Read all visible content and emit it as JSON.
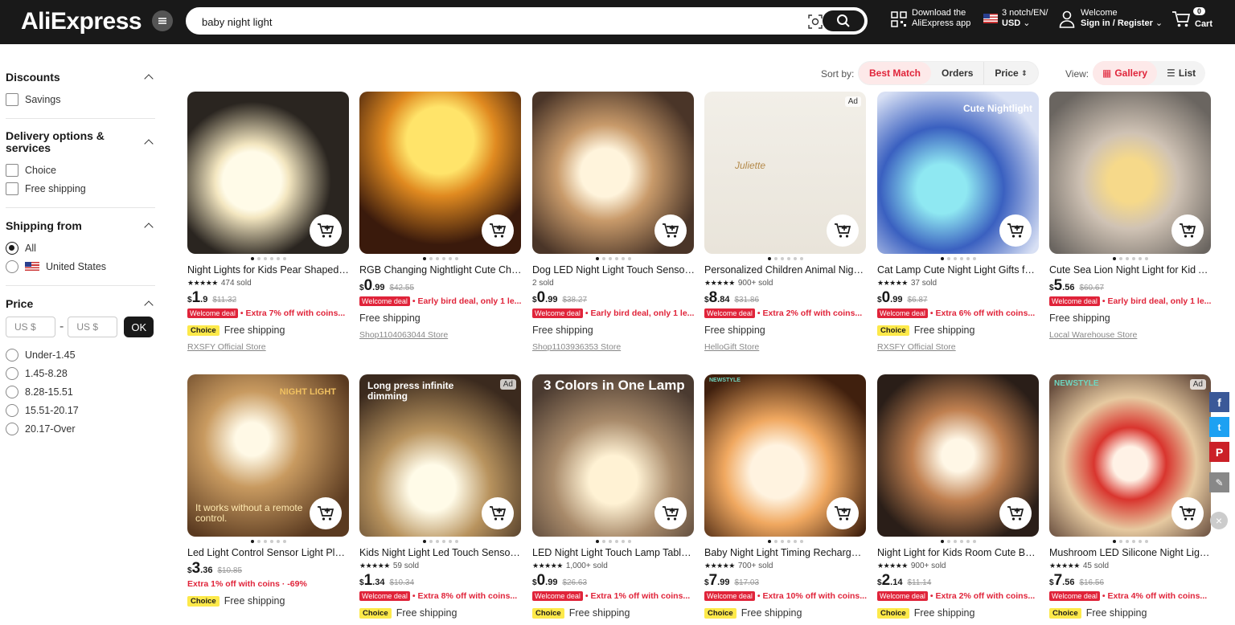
{
  "header": {
    "logo": "AliExpress",
    "search_value": "baby night light",
    "download_line1": "Download the",
    "download_line2": "AliExpress app",
    "locale_line1": "3 notch/EN/",
    "locale_line2": "USD",
    "welcome": "Welcome",
    "signin": "Sign in / Register",
    "cart_count": "0",
    "cart_label": "Cart"
  },
  "sidebar": {
    "discounts": {
      "title": "Discounts",
      "options": [
        "Savings"
      ]
    },
    "delivery": {
      "title": "Delivery options & services",
      "options": [
        "Choice",
        "Free shipping"
      ]
    },
    "shipping_from": {
      "title": "Shipping from",
      "options": [
        "All",
        "United States"
      ]
    },
    "price": {
      "title": "Price",
      "min_placeholder": "US $",
      "max_placeholder": "US $",
      "ok": "OK",
      "ranges": [
        "Under-1.45",
        "1.45-8.28",
        "8.28-15.51",
        "15.51-20.17",
        "20.17-Over"
      ]
    }
  },
  "sortbar": {
    "sort_label": "Sort by:",
    "sort_options": [
      "Best Match",
      "Orders",
      "Price"
    ],
    "view_label": "View:",
    "view_options": [
      "Gallery",
      "List"
    ]
  },
  "products": [
    {
      "title": "Night Lights for Kids Pear Shaped C...",
      "sold": "474 sold",
      "stars": true,
      "cur": "$",
      "int": "1",
      "dec": ".9",
      "old": "$11.32",
      "welcome": true,
      "deal": "Extra 7% off with coins...",
      "choice": true,
      "ship": "Free shipping",
      "store": "RXSFY Official Store",
      "ad": false
    },
    {
      "title": "RGB Changing Nightlight Cute Chick...",
      "sold": "",
      "stars": false,
      "cur": "$",
      "int": "0",
      "dec": ".99",
      "old": "$42.55",
      "welcome": true,
      "deal": "Early bird deal, only 1 le...",
      "choice": false,
      "ship": "Free shipping",
      "store": "Shop1104063044 Store",
      "ad": false
    },
    {
      "title": "Dog LED Night Light Touch Sensor ...",
      "sold": "2 sold",
      "stars": false,
      "cur": "$",
      "int": "0",
      "dec": ".99",
      "old": "$38.27",
      "welcome": true,
      "deal": "Early bird deal, only 1 le...",
      "choice": false,
      "ship": "Free shipping",
      "store": "Shop1103936353 Store",
      "ad": false
    },
    {
      "title": "Personalized Children Animal Night-...",
      "sold": "900+ sold",
      "stars": true,
      "cur": "$",
      "int": "8",
      "dec": ".84",
      "old": "$31.86",
      "welcome": true,
      "deal": "Extra 2% off with coins...",
      "choice": false,
      "ship": "Free shipping",
      "store": "HelloGift Store",
      "ad": true
    },
    {
      "title": "Cat Lamp Cute Night Light Gifts for...",
      "sold": "37 sold",
      "stars": true,
      "cur": "$",
      "int": "0",
      "dec": ".99",
      "old": "$6.87",
      "welcome": true,
      "deal": "Extra 6% off with coins...",
      "choice": true,
      "ship": "Free shipping",
      "store": "RXSFY Official Store",
      "ad": false
    },
    {
      "title": "Cute Sea Lion Night Light for Kid Ad...",
      "sold": "",
      "stars": false,
      "cur": "$",
      "int": "5",
      "dec": ".56",
      "old": "$60.67",
      "welcome": true,
      "deal": "Early bird deal, only 1 le...",
      "choice": false,
      "ship": "Free shipping",
      "store": "Local Warehouse Store",
      "ad": false
    },
    {
      "title": "Led Light Control Sensor Light Plug-...",
      "sold": "",
      "stars": false,
      "cur": "$",
      "int": "3",
      "dec": ".36",
      "old": "$10.85",
      "welcome": false,
      "deal": "Extra 1% off with coins · -69%",
      "choice": true,
      "ship": "Free shipping",
      "store": "",
      "ad": false
    },
    {
      "title": "Kids Night Light Led Touch Sensor L...",
      "sold": "59 sold",
      "stars": true,
      "cur": "$",
      "int": "1",
      "dec": ".34",
      "old": "$10.34",
      "welcome": true,
      "deal": "Extra 8% off with coins...",
      "choice": true,
      "ship": "Free shipping",
      "store": "",
      "ad": true
    },
    {
      "title": "LED Night Light Touch Lamp Table ...",
      "sold": "1,000+ sold",
      "stars": true,
      "cur": "$",
      "int": "0",
      "dec": ".99",
      "old": "$26.63",
      "welcome": true,
      "deal": "Extra 1% off with coins...",
      "choice": true,
      "ship": "Free shipping",
      "store": "",
      "ad": false
    },
    {
      "title": "Baby Night Light Timing Rechargea...",
      "sold": "700+ sold",
      "stars": true,
      "cur": "$",
      "int": "7",
      "dec": ".99",
      "old": "$17.03",
      "welcome": true,
      "deal": "Extra 10% off with coins...",
      "choice": true,
      "ship": "Free shipping",
      "store": "",
      "ad": false
    },
    {
      "title": "Night Light for Kids Room Cute Bun...",
      "sold": "900+ sold",
      "stars": true,
      "cur": "$",
      "int": "2",
      "dec": ".14",
      "old": "$11.14",
      "welcome": true,
      "deal": "Extra 2% off with coins...",
      "choice": true,
      "ship": "Free shipping",
      "store": "",
      "ad": false
    },
    {
      "title": "Mushroom LED Silicone Night Light ...",
      "sold": "45 sold",
      "stars": true,
      "cur": "$",
      "int": "7",
      "dec": ".56",
      "old": "$16.56",
      "welcome": true,
      "deal": "Extra 4% off with coins...",
      "choice": true,
      "ship": "Free shipping",
      "store": "",
      "ad": true
    }
  ],
  "image_texts": {
    "p5": "Cute Nightlight",
    "p7": "It works without a remote control.",
    "p7b": "NIGHT LIGHT",
    "p8": "Long press infinite dimming",
    "p9": "3 Colors in One Lamp",
    "p10": "NEWSTYLE",
    "p12": "NEWSTYLE",
    "p4": "Juliette"
  },
  "labels": {
    "welcome_deal": "Welcome deal",
    "choice": "Choice",
    "ad": "Ad"
  },
  "colors": {
    "accent": "#e0243a",
    "header_bg": "#191919",
    "choice_yellow": "#fde94a"
  }
}
